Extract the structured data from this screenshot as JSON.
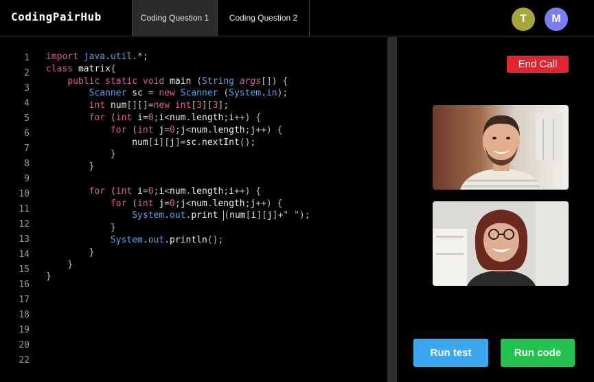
{
  "app": {
    "brand": "CodingPairHub"
  },
  "tabs": [
    {
      "label": "Coding Question 1",
      "active": true
    },
    {
      "label": "Coding Question 2",
      "active": false
    }
  ],
  "participants": [
    {
      "initial": "T",
      "color": "#a8a63a"
    },
    {
      "initial": "M",
      "color": "#7b7ef0"
    }
  ],
  "editor": {
    "line_numbers": [
      "1",
      "2",
      "3",
      "4",
      "5",
      "6",
      "7",
      "8",
      "9",
      "10",
      "11",
      "12",
      "13",
      "14",
      "15",
      "16",
      "17",
      "18",
      "19",
      "20",
      "22"
    ],
    "lines": [
      "import java.util.*;",
      "class matrix{",
      "    public static void main (String args[]) {",
      "        Scanner sc = new Scanner (System.in);",
      "        int num[][]=new int[3][3];",
      "        for (int i=0;i<num.length;i++) {",
      "            for (int j=0;j<num.length;j++) {",
      "                num[i][j]=sc.nextInt();",
      "            }",
      "        }",
      "",
      "        for (int i=0;i<num.length;i++) {",
      "            for (int j=0;j<num.length;j++) {",
      "                System.out.print (num[i][j]+\" \");",
      "            }",
      "            System.out.println();",
      "        }",
      "    }",
      "}"
    ]
  },
  "call": {
    "end_call_label": "End Call",
    "end_call_color": "#e0262e",
    "videos": [
      {
        "name": "video-participant-1"
      },
      {
        "name": "video-participant-2"
      }
    ]
  },
  "actions": {
    "run_test_label": "Run test",
    "run_code_label": "Run code",
    "run_test_color": "#3aa8f0",
    "run_code_color": "#22c24e"
  }
}
